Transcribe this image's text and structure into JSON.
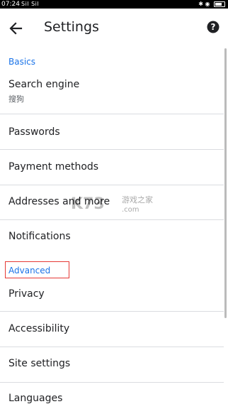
{
  "status_bar": {
    "time": "07:24",
    "signal_text": "Sil Sil",
    "right_text": "✱ ◉"
  },
  "appbar": {
    "title": "Settings"
  },
  "sections": {
    "basics": "Basics",
    "advanced": "Advanced"
  },
  "items": {
    "search_engine": {
      "title": "Search engine",
      "subtitle": "搜狗"
    },
    "passwords": {
      "title": "Passwords"
    },
    "payment_methods": {
      "title": "Payment methods"
    },
    "addresses": {
      "title": "Addresses and more"
    },
    "notifications": {
      "title": "Notifications"
    },
    "privacy": {
      "title": "Privacy"
    },
    "accessibility": {
      "title": "Accessibility"
    },
    "site_settings": {
      "title": "Site settings"
    },
    "languages": {
      "title": "Languages"
    }
  },
  "watermark": {
    "text": "游戏之家",
    "domain": ".com"
  },
  "colors": {
    "accent": "#1a73e8",
    "highlight": "#e53935",
    "divider": "#dadce0"
  }
}
